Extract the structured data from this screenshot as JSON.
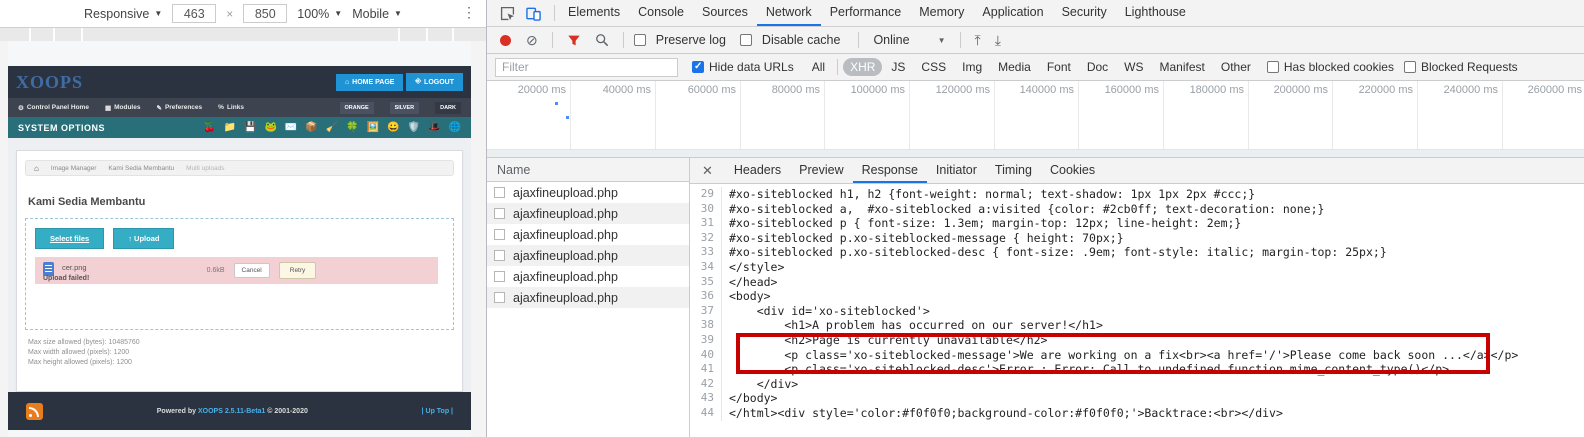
{
  "colors": {
    "accent_blue": "#1a73e8",
    "record_red": "#d93025",
    "highlight_red": "#c70000",
    "xoops_header": "#2b3340",
    "xoops_teal": "#286f7a",
    "xoops_button_blue": "#2093d5",
    "upload_error_pink": "#f3d0d3"
  },
  "device_toolbar": {
    "mode": "Responsive",
    "width": "463",
    "times": "×",
    "height": "850",
    "zoom": "100%",
    "throttle": "Mobile",
    "caret": "▼",
    "menu_icon": "⋮"
  },
  "page": {
    "logo": "XOOPS",
    "home_icon": "⌂",
    "home_button": "HOME PAGE",
    "logout_icon": "⎆",
    "logout_button": "LOGOUT",
    "nav": [
      {
        "icon": "⚙",
        "label": "Control Panel Home"
      },
      {
        "icon": "▦",
        "label": "Modules"
      },
      {
        "icon": "✎",
        "label": "Preferences"
      },
      {
        "icon": "%",
        "label": "Links"
      }
    ],
    "themes": [
      "ORANGE",
      "SILVER",
      "DARK"
    ],
    "section_title": "SYSTEM OPTIONS",
    "toolbar_icons": [
      "🍒",
      "📁",
      "💾",
      "🐸",
      "✉️",
      "📦",
      "🧹",
      "🍀",
      "🖼️",
      "😀",
      "🛡️",
      "🎩",
      "🌐"
    ],
    "breadcrumb_home_icon": "⌂",
    "breadcrumb": [
      "Image Manager",
      "Kami Sedia Membantu",
      "Multi uploads"
    ],
    "heading": "Kami Sedia Membantu",
    "select_files_button": "Select files",
    "upload_icon": "↑",
    "upload_button": "Upload",
    "file": {
      "name": "cer.png",
      "status": "Upload failed!",
      "size": "0.6kB",
      "cancel": "Cancel",
      "retry": "Retry"
    },
    "limits": [
      "Max size allowed (bytes): 10485760",
      "Max width allowed (pixels): 1200",
      "Max height allowed (pixels): 1200"
    ],
    "footer": {
      "powered_prefix": "Powered by",
      "powered_link": "XOOPS 2.5.11-Beta1",
      "powered_suffix": "© 2001-2020",
      "uptop": "| Up Top |"
    }
  },
  "devtools": {
    "main_tabs": [
      "Elements",
      "Console",
      "Sources",
      "Network",
      "Performance",
      "Memory",
      "Application",
      "Security",
      "Lighthouse"
    ],
    "active_tab": "Network",
    "toolbar": {
      "clear_icon": "⊘",
      "preserve_log": "Preserve log",
      "disable_cache": "Disable cache",
      "throttling": "Online",
      "caret": "▼",
      "import_icon": "⤒",
      "export_icon": "⤓"
    },
    "filter": {
      "placeholder": "Filter",
      "hide_data_urls": "Hide data URLs",
      "types": [
        "All",
        "XHR",
        "JS",
        "CSS",
        "Img",
        "Media",
        "Font",
        "Doc",
        "WS",
        "Manifest",
        "Other"
      ],
      "active_type": "XHR",
      "has_blocked_cookies": "Has blocked cookies",
      "blocked_requests": "Blocked Requests"
    },
    "timeline_ticks": [
      "20000 ms",
      "40000 ms",
      "60000 ms",
      "80000 ms",
      "100000 ms",
      "120000 ms",
      "140000 ms",
      "160000 ms",
      "180000 ms",
      "200000 ms",
      "220000 ms",
      "240000 ms",
      "260000 ms"
    ],
    "requests": {
      "header": "Name",
      "rows": [
        "ajaxfineupload.php",
        "ajaxfineupload.php",
        "ajaxfineupload.php",
        "ajaxfineupload.php",
        "ajaxfineupload.php",
        "ajaxfineupload.php"
      ]
    },
    "detail": {
      "close_icon": "✕",
      "tabs": [
        "Headers",
        "Preview",
        "Response",
        "Initiator",
        "Timing",
        "Cookies"
      ],
      "active_tab": "Response"
    },
    "code_lines": [
      {
        "n": "29",
        "t": "#xo-siteblocked h1, h2 {font-weight: normal; text-shadow: 1px 1px 2px #ccc;}"
      },
      {
        "n": "30",
        "t": "#xo-siteblocked a,  #xo-siteblocked a:visited {color: #2cb0ff; text-decoration: none;}"
      },
      {
        "n": "31",
        "t": "#xo-siteblocked p { font-size: 1.3em; margin-top: 12px; line-height: 2em;}"
      },
      {
        "n": "32",
        "t": "#xo-siteblocked p.xo-siteblocked-message { height: 70px;}"
      },
      {
        "n": "33",
        "t": "#xo-siteblocked p.xo-siteblocked-desc { font-size: .9em; font-style: italic; margin-top: 25px;}"
      },
      {
        "n": "34",
        "t": "</style>"
      },
      {
        "n": "35",
        "t": "</head>"
      },
      {
        "n": "36",
        "t": "<body>"
      },
      {
        "n": "37",
        "t": "    <div id='xo-siteblocked'>"
      },
      {
        "n": "38",
        "t": "        <h1>A problem has occurred on our server!</h1>"
      },
      {
        "n": "39",
        "t": "        <h2>Page is currently unavailable</h2>"
      },
      {
        "n": "40",
        "t": "        <p class='xo-siteblocked-message'>We are working on a fix<br><a href='/'>Please come back soon ...</a></p>"
      },
      {
        "n": "41",
        "t": "        <p class='xo-siteblocked-desc'>Error : Error: Call to undefined function mime_content_type()</p>"
      },
      {
        "n": "42",
        "t": "    </div>"
      },
      {
        "n": "43",
        "t": "</body>"
      },
      {
        "n": "44",
        "t": "</html><div style='color:#f0f0f0;background-color:#f0f0f0;'>Backtrace:<br></div>"
      }
    ]
  }
}
